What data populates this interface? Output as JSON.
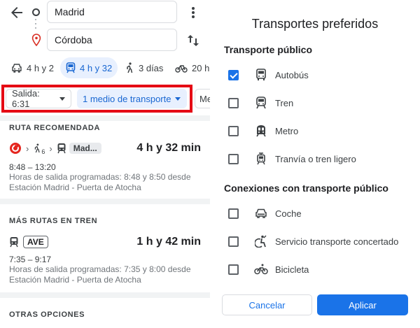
{
  "search": {
    "origin": "Madrid",
    "destination": "Córdoba"
  },
  "modes": [
    {
      "icon": "car-icon",
      "label": "4 h y 2"
    },
    {
      "icon": "transit-icon",
      "label": "4 h y 32",
      "selected": true
    },
    {
      "icon": "walk-icon",
      "label": "3 días"
    },
    {
      "icon": "bike-icon",
      "label": "20 h"
    }
  ],
  "filters": {
    "salida": "Salida: 6:31",
    "medio": "1 medio de transporte",
    "more": "Me"
  },
  "recommended": {
    "heading": "RUTA RECOMENDADA",
    "walk_sub": "6",
    "train_badge": "Mad...",
    "duration": "4 h y 32 min",
    "times": "8:48 – 13:20",
    "note_line1": "Horas de salida programadas: 8:48 y 8:50 desde",
    "note_line2": "Estación Madrid - Puerta de Atocha"
  },
  "train_routes": {
    "heading": "MÁS RUTAS EN TREN",
    "badge": "AVE",
    "duration": "1 h y 42 min",
    "times": "7:35 – 9:17",
    "note_line1": "Horas de salida programadas: 7:35 y 8:00 desde",
    "note_line2": "Estación Madrid - Puerta de Atocha"
  },
  "other": {
    "heading": "OTRAS OPCIONES"
  },
  "dialog": {
    "title": "Transportes preferidos",
    "public_title": "Transporte público",
    "public_options": [
      {
        "label": "Autobús",
        "checked": true
      },
      {
        "label": "Tren",
        "checked": false
      },
      {
        "label": "Metro",
        "checked": false
      },
      {
        "label": "Tranvía o tren ligero",
        "checked": false
      }
    ],
    "connections_title": "Conexiones con transporte público",
    "connection_options": [
      {
        "label": "Coche",
        "checked": false
      },
      {
        "label": "Servicio transporte concertado",
        "checked": false
      },
      {
        "label": "Bicicleta",
        "checked": false
      }
    ],
    "cancel": "Cancelar",
    "apply": "Aplicar"
  },
  "colors": {
    "accent": "#1a73e8",
    "selected_bg": "#e8f0fe",
    "highlight_frame": "#e50914",
    "pin": "#d93025"
  }
}
